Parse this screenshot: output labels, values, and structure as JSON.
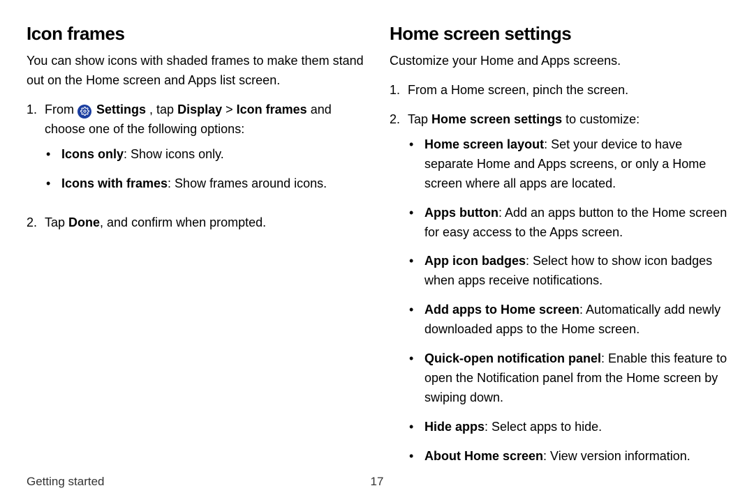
{
  "left": {
    "heading": "Icon frames",
    "intro": "You can show icons with shaded frames to make them stand out on the Home screen and Apps list screen.",
    "step1_lead": "From ",
    "settings_label": "Settings",
    "step1_mid": ", tap ",
    "display_label": "Display",
    "chevron": " > ",
    "iconframes_label": "Icon frames",
    "step1_tail": " and choose one of the following options:",
    "opt1_b": "Icons only",
    "opt1_txt": ": Show icons only.",
    "opt2_b": "Icons with frames",
    "opt2_txt": ": Show frames around icons.",
    "step2_a": "Tap ",
    "step2_b": "Done",
    "step2_c": ", and confirm when prompted."
  },
  "right": {
    "heading": "Home screen settings",
    "intro": "Customize your Home and Apps screens.",
    "step1": "From a Home screen, pinch the screen.",
    "step2_a": "Tap ",
    "step2_b": "Home screen settings",
    "step2_c": " to customize:",
    "b1_b": "Home screen layout",
    "b1_t": ": Set your device to have separate Home and Apps screens, or only a Home screen where all apps are located.",
    "b2_b": "Apps button",
    "b2_t": ": Add an apps button to the Home screen for easy access to the Apps screen.",
    "b3_b": "App icon badges",
    "b3_t": ": Select how to show icon badges when apps receive notifications.",
    "b4_b": "Add apps to Home screen",
    "b4_t": ": Automatically add newly downloaded apps to the Home screen.",
    "b5_b": "Quick-open notification panel",
    "b5_t": ": Enable this feature to open the Notification panel from the Home screen by swiping down.",
    "b6_b": "Hide apps",
    "b6_t": ": Select apps to hide.",
    "b7_b": "About Home screen",
    "b7_t": ": View version information."
  },
  "footer": {
    "section": "Getting started",
    "page": "17"
  },
  "num1": "1.",
  "num2": "2.",
  "dot": "•"
}
